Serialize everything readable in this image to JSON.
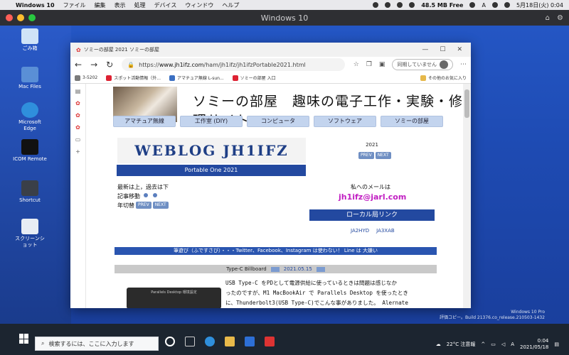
{
  "mac_menubar": {
    "app_name": "Windows 10",
    "menus": [
      "ファイル",
      "編集",
      "表示",
      "処理",
      "デバイス",
      "ウィンドウ",
      "ヘルプ"
    ],
    "memory": "48.5 MB Free",
    "input_mode": "A",
    "datetime": "5月18日(火) 0:04"
  },
  "vm_window": {
    "title": "Windows 10"
  },
  "desktop_icons": [
    {
      "label": "ごみ箱"
    },
    {
      "label": "Mac Files"
    },
    {
      "label": "Microsoft Edge"
    },
    {
      "label": "ICOM Remote"
    },
    {
      "label": "Shortcut"
    },
    {
      "label": "スクリーンショット"
    }
  ],
  "browser": {
    "tab_title": "ソミーの部屋 2021 ソミーの部屋",
    "url_prefix": "https://",
    "url_host": "www.jh1ifz.com",
    "url_path": "/ham/jh1ifz/jh1ifzPortable2021.html",
    "sync_label": "同期していません",
    "favorites": [
      "3-5202",
      "スポット活動情報（外...",
      "アマチュア無線 L-sun...",
      "ソミーの部屋 入口"
    ],
    "other_favorites": "その他のお気に入り"
  },
  "page": {
    "site_title": "ソミーの部屋　趣味の電子工作・実験・修理サイト",
    "nav": [
      "アマチュア無線",
      "工作室 (DIY)",
      "コンピュータ",
      "ソフトウェア",
      "ソミーの部屋"
    ],
    "weblog_title": "WEBLOG JH1IFZ",
    "portable_bar": "Portable One 2021",
    "year": "2021",
    "prev_label": "PREV",
    "next_label": "NEXT",
    "order_note": "最新は上，過去は下",
    "article_move": "記事移動",
    "year_switch": "年切替",
    "mail_label": "私へのメールは",
    "mail_address": "jh1ifz@jarl.com",
    "local_links_title": "ローカル局リンク",
    "local_links": [
      "JA2HYD",
      "JA3XAB"
    ],
    "notice_strip": "筆遊び（ふですさび）・・・Twitter、Facebook、Instagram は使わない！ Line は 大嫌い",
    "section_title": "Type-C Billboard",
    "section_date": "2021.05.15",
    "thumb_caption": "Parallels Desktop 環境設定",
    "body_lines": [
      "USB Type-C をPDとして電源供給に使っているときは問題は感じなか",
      "ったのですが、M1 MacBookAir で Parallels Desktop を使ったとき",
      "に、Thunderbolt3(USB Type-C)でこんな事がありました。 Alernate"
    ]
  },
  "windows_note": {
    "line1": "Windows 10 Pro",
    "line2": "評価コピー。Build 21376.co_release.210503-1432"
  },
  "taskbar": {
    "search_placeholder": "検索するには、ここに入力します",
    "weather": "22°C 注意報",
    "ime": "A",
    "time": "0:04",
    "date": "2021/05/18"
  },
  "colors": {
    "nav_button": "#c3d4ee",
    "accent_blue": "#2349a0",
    "mail_magenta": "#c11ec2",
    "desktop_blue": "#2456c4"
  }
}
